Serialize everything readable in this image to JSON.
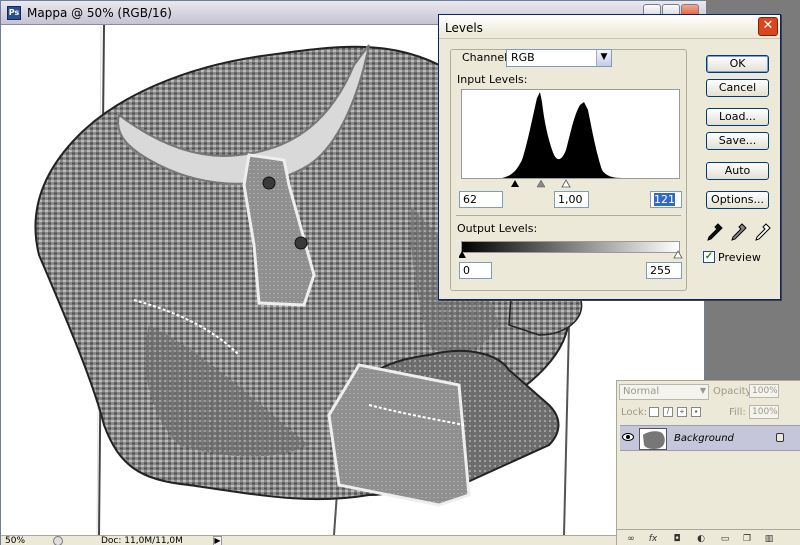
{
  "document": {
    "title": "Mappa @ 50% (RGB/16)",
    "zoom": "50%",
    "doc_size": "Doc: 11,0M/11,0M",
    "image_subject": "shirt-photo"
  },
  "levels": {
    "title": "Levels",
    "channel_label": "Channel:",
    "channel_value": "RGB",
    "input_label": "Input Levels:",
    "input_black": "62",
    "input_gamma": "1,00",
    "input_white": "121",
    "output_label": "Output Levels:",
    "output_black": "0",
    "output_white": "255",
    "buttons": {
      "ok": "OK",
      "cancel": "Cancel",
      "load": "Load...",
      "save": "Save...",
      "auto": "Auto",
      "options": "Options..."
    },
    "preview_label": "Preview",
    "preview_checked": true
  },
  "layers": {
    "blend_mode": "Normal",
    "opacity_label": "Opacity:",
    "opacity_value": "100%",
    "lock_label": "Lock:",
    "fill_label": "Fill:",
    "fill_value": "100%",
    "layer_name": "Background",
    "bottom_icons": [
      "link-icon",
      "fx-icon",
      "mask-icon",
      "adjustment-icon",
      "folder-icon",
      "new-layer-icon",
      "trash-icon"
    ]
  },
  "colors": {
    "dialog_bg": "#ece9d8",
    "title_close": "#d9471f",
    "selection": "#316ac5"
  }
}
